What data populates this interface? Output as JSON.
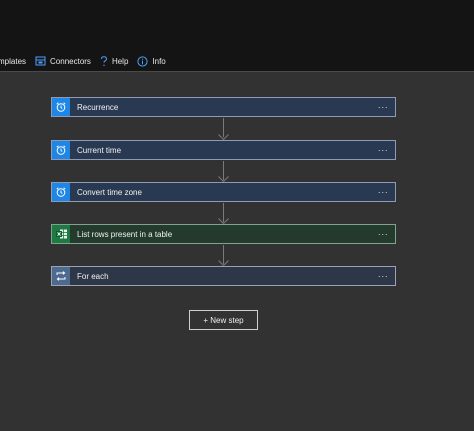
{
  "toolbar": {
    "items": [
      {
        "label": "mplates",
        "icon": "templates-icon"
      },
      {
        "label": "Connectors",
        "icon": "connectors-icon"
      },
      {
        "label": "Help",
        "icon": "help-icon"
      },
      {
        "label": "Info",
        "icon": "info-icon"
      }
    ]
  },
  "flow": {
    "steps": [
      {
        "title": "Recurrence",
        "icon": "alarm-clock-icon",
        "more": "···"
      },
      {
        "title": "Current time",
        "icon": "alarm-clock-icon",
        "more": "···"
      },
      {
        "title": "Convert time zone",
        "icon": "alarm-clock-icon",
        "more": "···"
      },
      {
        "title": "List rows present in a table",
        "icon": "excel-icon",
        "more": "···"
      },
      {
        "title": "For each",
        "icon": "loop-icon",
        "more": "···"
      }
    ],
    "new_step_label": "+ New step"
  },
  "colors": {
    "canvas": "#323232",
    "topbar": "#141414",
    "schedule_blue": "#1f86e6",
    "excel_green": "#1d7a43"
  }
}
